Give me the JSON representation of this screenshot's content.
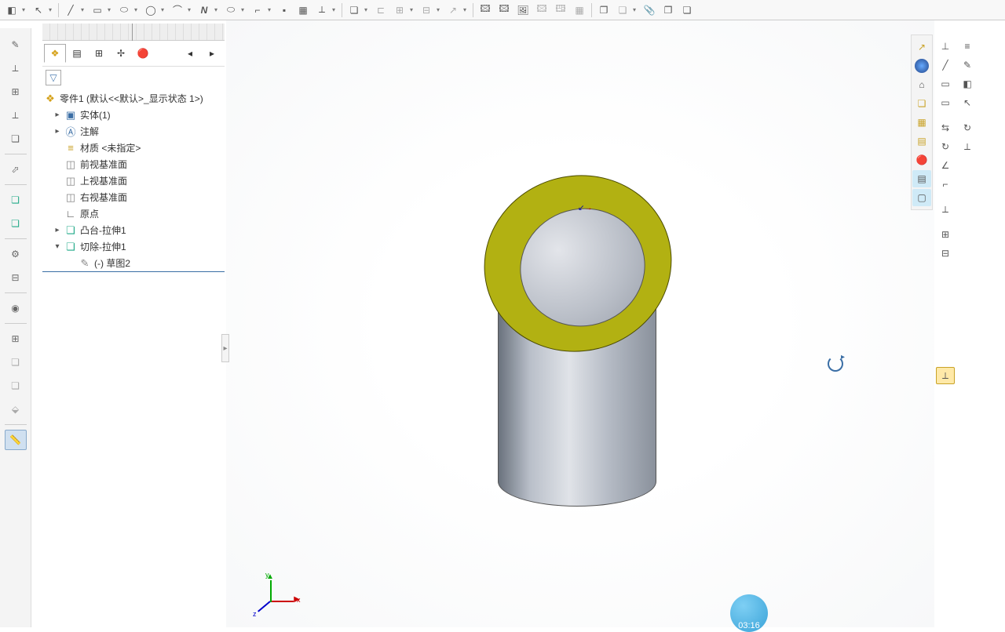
{
  "top_toolbar_icons": [
    "plane",
    "arrow",
    "line",
    "rect",
    "slot",
    "circle",
    "arc",
    "spline",
    "ellipse",
    "fillet",
    "point",
    "trim",
    "dim",
    "",
    "cube",
    "chamfer",
    "pattern",
    "mirror",
    "loft",
    "",
    "annot1",
    "annot2",
    "insert-img",
    "annot4",
    "annot5",
    "annot6",
    "",
    "attach",
    "cube2",
    "attach2",
    "link",
    "ref"
  ],
  "view_toolbar_icons": [
    "zoom",
    "zoom-window",
    "zoom-fit",
    "section",
    "scene",
    "appearance",
    "display-style",
    "hide",
    "color1",
    "color2",
    "screen"
  ],
  "window_controls": [
    "prev",
    "next",
    "min",
    "restore",
    "close"
  ],
  "left_sidebar": [
    "sketch",
    "dim",
    "pattern",
    "dim2",
    "feat",
    "",
    "extrude",
    "extrude2",
    "",
    "gear",
    "rel",
    "",
    "sens",
    "",
    "mirror2",
    "cube3",
    "loft2",
    "deform",
    "",
    "measure"
  ],
  "panel_tabs": [
    "feature-tree",
    "property",
    "config",
    "display",
    "appearance"
  ],
  "panel_nav": [
    "prev",
    "next"
  ],
  "tree": {
    "root": "零件1 (默认<<默认>_显示状态 1>)",
    "nodes": [
      {
        "icon": "solid",
        "label": "实体(1)",
        "indent": 1,
        "exp": "▸"
      },
      {
        "icon": "annot",
        "label": "注解",
        "indent": 1,
        "exp": "▸"
      },
      {
        "icon": "material",
        "label": "材质 <未指定>",
        "indent": 1,
        "exp": ""
      },
      {
        "icon": "plane",
        "label": "前视基准面",
        "indent": 1,
        "exp": ""
      },
      {
        "icon": "plane",
        "label": "上视基准面",
        "indent": 1,
        "exp": ""
      },
      {
        "icon": "plane",
        "label": "右视基准面",
        "indent": 1,
        "exp": ""
      },
      {
        "icon": "origin",
        "label": "原点",
        "indent": 1,
        "exp": ""
      },
      {
        "icon": "boss",
        "label": "凸台-拉伸1",
        "indent": 1,
        "exp": "▸"
      },
      {
        "icon": "cut",
        "label": "切除-拉伸1",
        "indent": 1,
        "exp": "▾"
      },
      {
        "icon": "sketch",
        "label": "(-) 草图2",
        "indent": 2,
        "exp": ""
      }
    ]
  },
  "right_bar": [
    "arrow-ne",
    "globe",
    "home",
    "iso",
    "layers",
    "folder",
    "color-wheel",
    "list",
    "callout"
  ],
  "right_bar2": [
    "axis",
    "line-tool",
    "box",
    "box2",
    "",
    "swap",
    "drag",
    "angle",
    "corner",
    "",
    "axis2",
    "",
    "grid",
    "split"
  ],
  "right_bar3": [
    "ruler",
    "pencil",
    "eraser",
    "cursor",
    "",
    "redo",
    "const",
    "",
    "",
    "highlight",
    "",
    "",
    "",
    ""
  ],
  "triad_labels": {
    "x": "x",
    "y": "y",
    "z": "z"
  },
  "timestamp": "03:16"
}
